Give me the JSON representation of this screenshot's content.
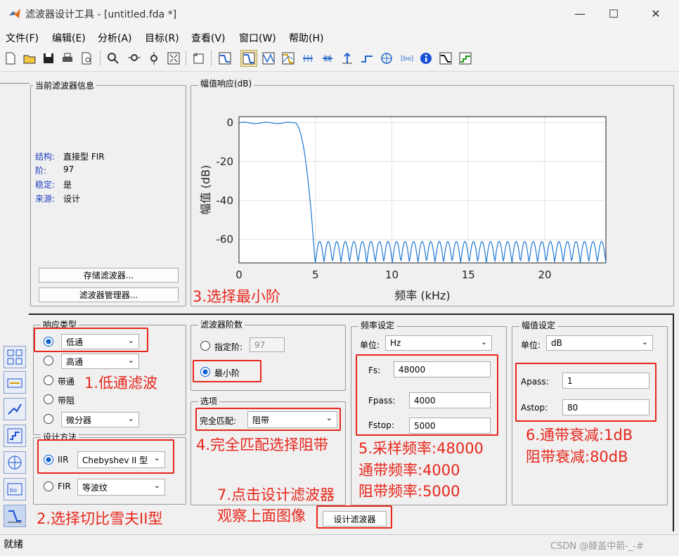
{
  "window": {
    "title": "滤波器设计工具 - [untitled.fda *]",
    "minimize": "—",
    "maximize": "☐",
    "close": "✕"
  },
  "menu": [
    "文件(F)",
    "编辑(E)",
    "分析(A)",
    "目标(R)",
    "查看(V)",
    "窗口(W)",
    "帮助(H)"
  ],
  "toolbar": {
    "icons": [
      "new-icon",
      "open-icon",
      "save-icon",
      "print-icon",
      "print-preview-icon",
      "zoom-in-icon",
      "zoom-x-icon",
      "zoom-y-icon",
      "full-view-icon",
      "new-plot-icon",
      "filter-spec-icon",
      "magnitude-icon",
      "phase-icon",
      "mag-phase-icon",
      "group-delay-icon",
      "phase-delay-icon",
      "impulse-icon",
      "step-icon",
      "pole-zero-icon",
      "coefficients-icon",
      "info-icon",
      "cost-icon",
      "noise-icon"
    ]
  },
  "info_panel": {
    "title": "当前滤波器信息",
    "rows": [
      {
        "k": "结构:",
        "v": "直接型 FIR"
      },
      {
        "k": "阶:",
        "v": "97"
      },
      {
        "k": "稳定:",
        "v": "是"
      },
      {
        "k": "来源:",
        "v": "设计"
      }
    ],
    "store_btn": "存储滤波器...",
    "manager_btn": "滤波器管理器..."
  },
  "plot": {
    "title": "幅值响应(dB)",
    "ylabel": "幅值 (dB)",
    "xlabel": "频率 (kHz)"
  },
  "chart_data": {
    "type": "line",
    "title": "幅值响应(dB)",
    "xlabel": "频率 (kHz)",
    "ylabel": "幅值 (dB)",
    "xlim": [
      0,
      24
    ],
    "ylim": [
      -72,
      3
    ],
    "xticks": [
      "0",
      "5",
      "10",
      "15",
      "20"
    ],
    "yticks": [
      "0",
      "-20",
      "-40",
      "-60"
    ],
    "passband_edge_khz": 4,
    "stopband_edge_khz": 5,
    "passband_level_db": 0,
    "passband_ripple_db": 1,
    "stopband_level_db": -61,
    "stopband_ripples": 34,
    "color": "#1f77d4"
  },
  "response": {
    "title": "响应类型",
    "options": [
      "低通",
      "高通",
      "带通",
      "带阻",
      "微分器"
    ],
    "selected": "低通",
    "lowpass_select": "低通",
    "highpass_select": "高通",
    "diff_select": "微分器"
  },
  "method": {
    "title": "设计方法",
    "iir_label": "IIR",
    "iir_select": "Chebyshev II 型",
    "fir_label": "FIR",
    "fir_select": "等波纹"
  },
  "order": {
    "title": "滤波器阶数",
    "specify_label": "指定阶:",
    "specify_value": "97",
    "min_label": "最小阶"
  },
  "options": {
    "title": "选项",
    "match_label": "完全匹配:",
    "match_value": "阻带"
  },
  "freq": {
    "title": "频率设定",
    "unit_label": "单位:",
    "unit_value": "Hz",
    "fs_label": "Fs:",
    "fs_value": "48000",
    "fpass_label": "Fpass:",
    "fpass_value": "4000",
    "fstop_label": "Fstop:",
    "fstop_value": "5000"
  },
  "mag": {
    "title": "幅值设定",
    "unit_label": "单位:",
    "unit_value": "dB",
    "apass_label": "Apass:",
    "apass_value": "1",
    "astop_label": "Astop:",
    "astop_value": "80"
  },
  "design_btn": "设计滤波器",
  "status": "就绪",
  "watermark": "CSDN @滕盖中箭-_-#",
  "annotations": {
    "a1": "1.低通滤波",
    "a2": "2.选择切比雪夫II型",
    "a3": "3.选择最小阶",
    "a4": "4.完全匹配选择阻带",
    "a5_1": "5.采样频率:48000",
    "a5_2": "通带频率:4000",
    "a5_3": "阻带频率:5000",
    "a6_1": "6.通带衰减:1dB",
    "a6_2": "阻带衰减:80dB",
    "a7_1": "7.点击设计滤波器",
    "a7_2": "观察上面图像"
  },
  "colors": {
    "accent": "#0a5fd1",
    "annotation": "#e8261b",
    "plot_line": "#1f77d4"
  }
}
